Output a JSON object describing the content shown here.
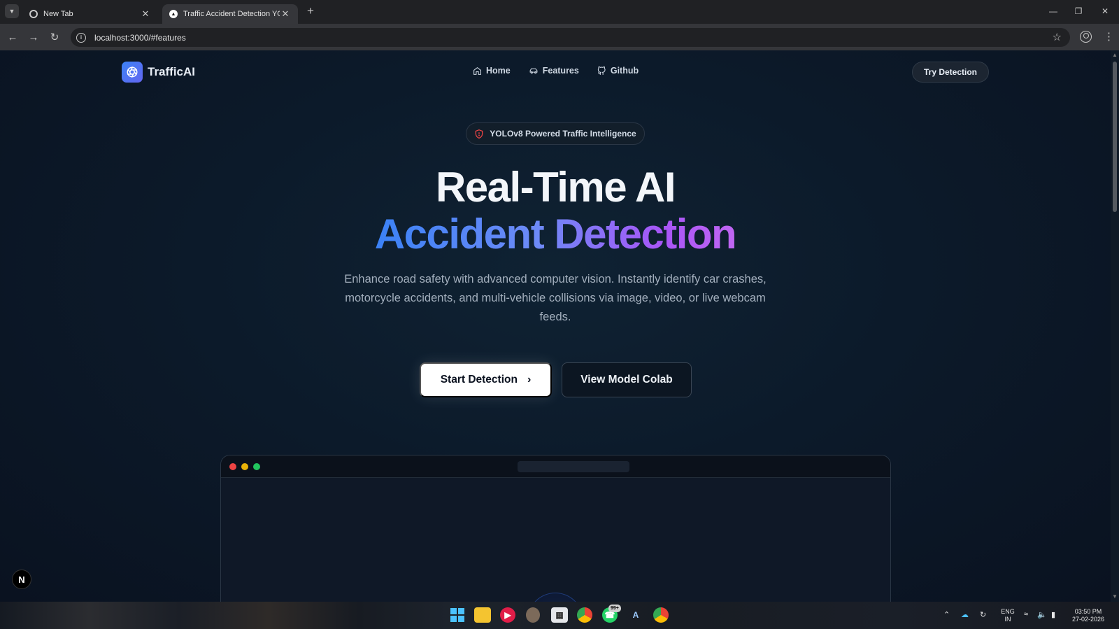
{
  "browser": {
    "tabs": [
      {
        "title": "New Tab",
        "active": false
      },
      {
        "title": "Traffic Accident Detection YOLO",
        "active": true
      }
    ],
    "url": "localhost:3000/#features"
  },
  "site": {
    "brand": "TrafficAI",
    "nav": [
      {
        "label": "Home",
        "icon": "home-icon"
      },
      {
        "label": "Features",
        "icon": "car-icon"
      },
      {
        "label": "Github",
        "icon": "github-icon"
      }
    ],
    "try_button": "Try Detection"
  },
  "hero": {
    "badge": "YOLOv8 Powered Traffic Intelligence",
    "title_line1": "Real-Time AI",
    "title_line2": "Accident Detection",
    "subtitle": "Enhance road safety with advanced computer vision. Instantly identify car crashes, motorcycle accidents, and multi-vehicle collisions via image, video, or live webcam feeds.",
    "primary_cta": "Start Detection",
    "secondary_cta": "View Model Colab"
  },
  "dev_badge": "N",
  "taskbar": {
    "notification_count": "99+",
    "language": "ENG",
    "region": "IN",
    "time": "03:50 PM",
    "date": "27-02-2026"
  },
  "colors": {
    "accent_blue": "#3b82f6",
    "accent_purple": "#a855f7",
    "background": "#0b1220"
  }
}
